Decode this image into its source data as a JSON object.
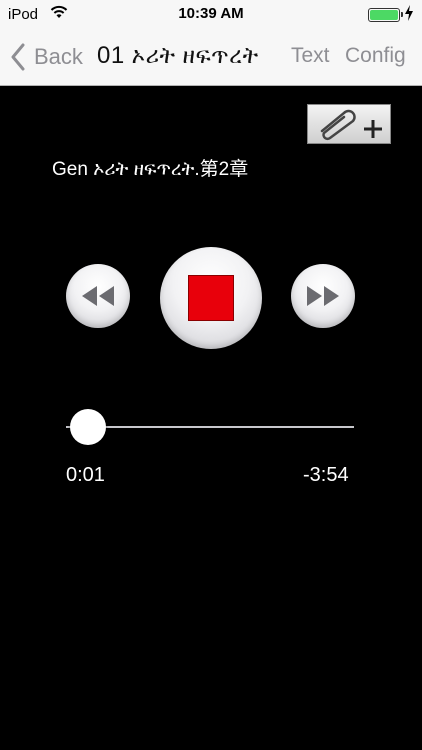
{
  "status": {
    "carrier": "iPod",
    "time": "10:39 AM"
  },
  "nav": {
    "back_label": "Back",
    "title_number": "01",
    "title_text": "ኦሪት ዘፍጥረት",
    "text_label": "Text",
    "config_label": "Config"
  },
  "track": {
    "title": "Gen ኦሪት ዘፍጥረት.第2章"
  },
  "player": {
    "elapsed": "0:01",
    "remaining": "-3:54",
    "progress_fraction": 0.004
  },
  "colors": {
    "stop_red": "#e8000b",
    "bar_bg": "#f7f7f7",
    "battery_green": "#4cd964"
  },
  "icons": {
    "attach": "paperclip-plus-icon",
    "rewind": "rewind-icon",
    "forward": "fast-forward-icon",
    "stop": "stop-icon"
  }
}
